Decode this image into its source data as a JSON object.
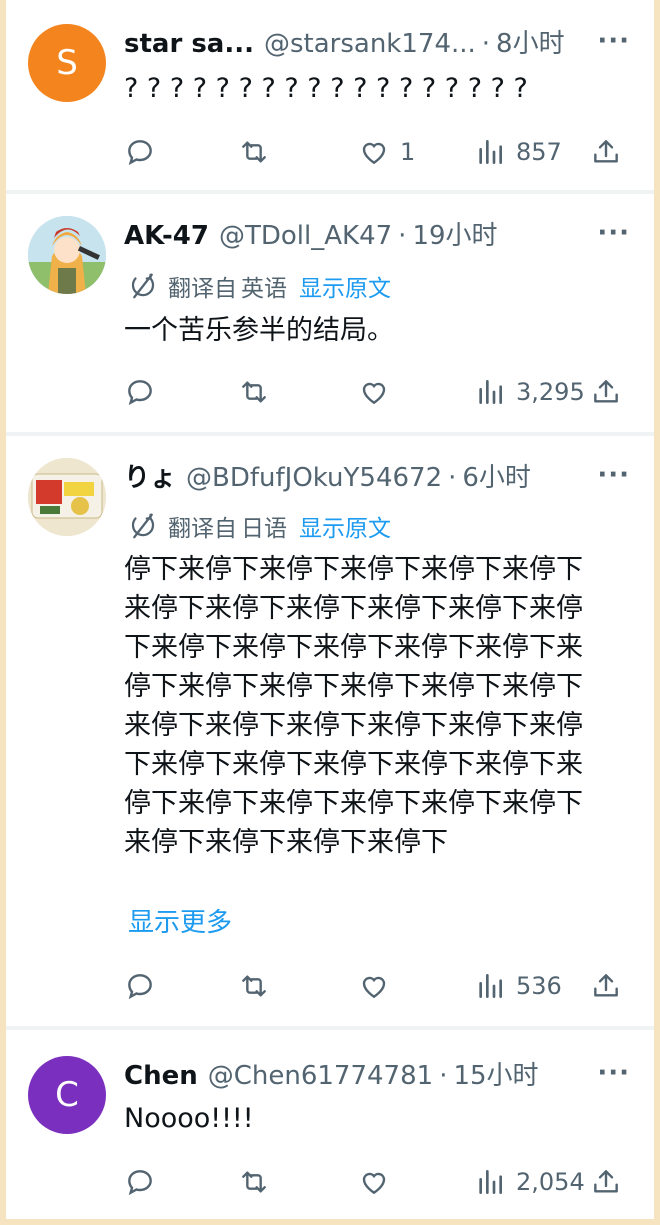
{
  "tweets": [
    {
      "avatar_letter": "S",
      "avatar_color": "#f4841d",
      "name": "star sa...",
      "handle": "@starsank174...",
      "time": "8小时",
      "text": "? ? ? ? ? ? ? ? ? ? ? ? ? ? ? ? ? ?",
      "likes": "1",
      "views": "857"
    },
    {
      "avatar_icon": "anime-girl-avatar",
      "name": "AK-47",
      "handle": "@TDoll_AK47",
      "time": "19小时",
      "translate_label": "翻译自",
      "translate_lang": "英语",
      "translate_show": "显示原文",
      "text": "一个苦乐参半的结局。",
      "views": "3,295"
    },
    {
      "avatar_icon": "snack-package-avatar",
      "name": "りょ",
      "handle": "@BDfufJOkuY54672",
      "time": "6小时",
      "translate_label": "翻译自",
      "translate_lang": "日语",
      "translate_show": "显示原文",
      "text": "停下来停下来停下来停下来停下来停下来停下来停下来停下来停下来停下来停下来停下来停下来停下来停下来停下来停下来停下来停下来停下来停下来停下来停下来停下来停下来停下来停下来停下来停下来停下来停下来停下来停下来停下来停下来停下来停下来停下来停下来停下来停下来停下来停下",
      "show_more": "显示更多",
      "views": "536"
    },
    {
      "avatar_letter": "C",
      "avatar_color": "#7b2fbe",
      "name": "Chen",
      "handle": "@Chen61774781",
      "time": "15小时",
      "text": "Noooo!!!!",
      "views": "2,054"
    }
  ],
  "dot": "·",
  "more": "···",
  "icons": [
    "reply-icon",
    "retweet-icon",
    "like-icon",
    "views-icon",
    "share-icon",
    "translate-icon"
  ],
  "colors": {
    "accent": "#1d9bf0",
    "muted": "#536471",
    "page_bg": "#f6e3bf"
  }
}
